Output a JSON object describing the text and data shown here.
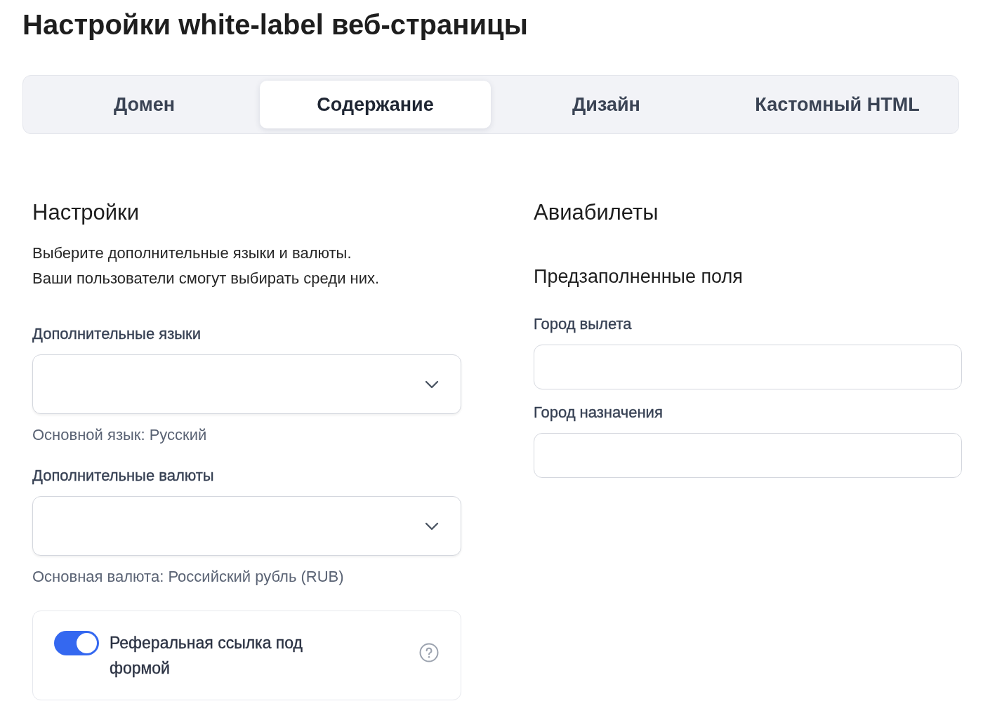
{
  "page": {
    "title": "Настройки white-label веб-страницы"
  },
  "tabs": [
    {
      "label": "Домен",
      "selected": false
    },
    {
      "label": "Содержание",
      "selected": true
    },
    {
      "label": "Дизайн",
      "selected": false
    },
    {
      "label": "Кастомный HTML",
      "selected": false
    }
  ],
  "settings": {
    "heading": "Настройки",
    "description": [
      "Выберите дополнительные языки и валюты.",
      "Ваши пользователи смогут выбирать среди них."
    ],
    "selects": [
      {
        "label": "Дополнительные языки",
        "hint": "Основной язык: Русский"
      },
      {
        "label": "Дополнительные валюты",
        "hint": "Основная валюта: Российский рубль (RUB)"
      }
    ],
    "referral": {
      "label": "Реферальная ссылка под формой",
      "on": true
    }
  },
  "flights": {
    "heading": "Авиабилеты",
    "subheading": "Предзаполненные поля",
    "fields": [
      {
        "label": "Город вылета"
      },
      {
        "label": "Город назначения"
      }
    ]
  }
}
